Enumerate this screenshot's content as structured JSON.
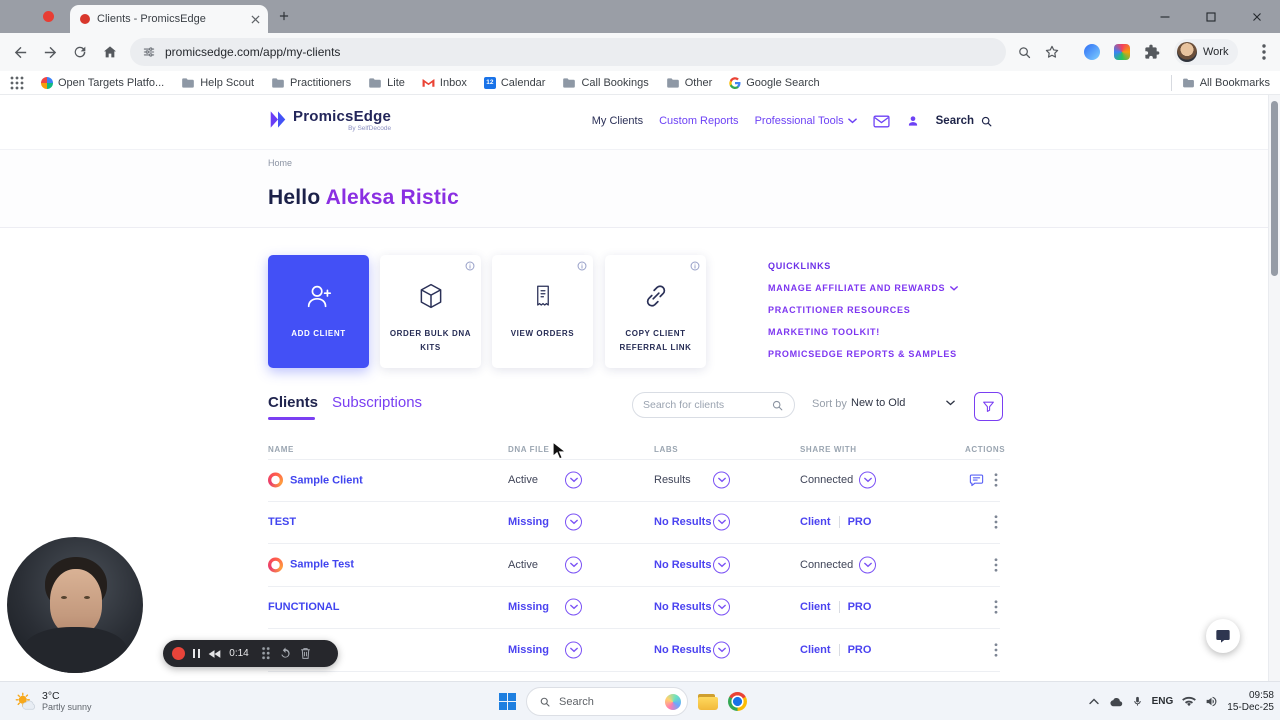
{
  "colors": {
    "accent_blue": "#4350f6",
    "accent_purple": "#7a3ff2",
    "link_blue": "#4b43f0",
    "greeting_purple": "#8a2fe2",
    "record_red": "#e8443a"
  },
  "browser": {
    "tab_title": "Clients - PromicsEdge",
    "url": "promicsedge.com/app/my-clients",
    "profile_label": "Work",
    "bookmarks": {
      "items": [
        {
          "label": "Open Targets Platfo..."
        },
        {
          "label": "Help Scout"
        },
        {
          "label": "Practitioners"
        },
        {
          "label": "Lite"
        },
        {
          "label": "Inbox"
        },
        {
          "label": "Calendar",
          "badge": "12"
        },
        {
          "label": "Call Bookings"
        },
        {
          "label": "Other"
        },
        {
          "label": "Google Search"
        }
      ],
      "all_bookmarks": "All Bookmarks"
    }
  },
  "site": {
    "logo_title": "PromicsEdge",
    "logo_subtitle": "By SelfDecode",
    "nav": {
      "my_clients": "My Clients",
      "custom_reports": "Custom Reports",
      "professional_tools": "Professional Tools",
      "search": "Search"
    },
    "breadcrumb": "Home",
    "greeting_prefix": "Hello",
    "greeting_name": "Aleksa Ristic",
    "cards": [
      {
        "label": "ADD CLIENT"
      },
      {
        "label": "ORDER BULK DNA KITS"
      },
      {
        "label": "VIEW ORDERS"
      },
      {
        "label": "COPY CLIENT REFERRAL LINK"
      }
    ],
    "quicklinks": {
      "title": "QUICKLINKS",
      "items": [
        "MANAGE AFFILIATE AND REWARDS",
        "PRACTITIONER RESOURCES",
        "MARKETING TOOLKIT!",
        "PROMICSEDGE REPORTS & SAMPLES"
      ]
    },
    "list": {
      "tab_clients": "Clients",
      "tab_subscriptions": "Subscriptions",
      "search_placeholder": "Search for clients",
      "sort_label": "Sort by",
      "sort_value": "New to Old",
      "columns": [
        "NAME",
        "DNA FILE",
        "LABS",
        "SHARE WITH",
        "ACTIONS"
      ],
      "share_client": "Client",
      "share_pro": "PRO",
      "rows": [
        {
          "name": "Sample Client",
          "dna": "Active",
          "labs": "Results",
          "share": "Connected"
        },
        {
          "name": "TEST",
          "dna": "Missing",
          "labs": "No Results"
        },
        {
          "name": "Sample Test",
          "dna": "Active",
          "labs": "No Results",
          "share": "Connected"
        },
        {
          "name": "FUNCTIONAL",
          "dna": "Missing",
          "labs": "No Results"
        },
        {
          "name": "",
          "dna": "Missing",
          "labs": "No Results"
        }
      ]
    }
  },
  "overlays": {
    "recorder_time": "0:14"
  },
  "taskbar": {
    "weather_temp": "3°C",
    "weather_condition": "Partly sunny",
    "search_placeholder": "Search",
    "language": "ENG",
    "time": "09:58",
    "date": "15-Dec-25"
  }
}
